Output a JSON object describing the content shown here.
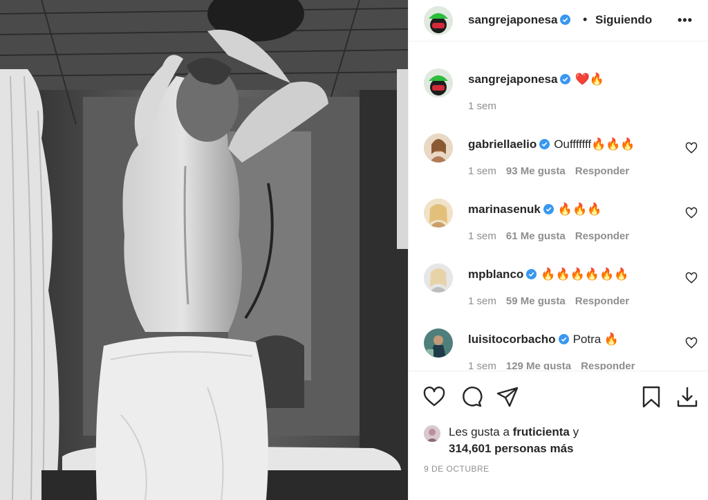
{
  "post": {
    "image_alt": "Fotografía en blanco y negro de una mujer de espaldas con una toalla en un baño rústico",
    "accent_color": "#0095f6"
  },
  "header": {
    "username": "sangrejaponesa",
    "separator": "•",
    "follow_label": "Siguiendo",
    "more_label": "•••",
    "avatar_icon": "avatar-green-hat-icon",
    "verified_icon": "verified-badge-icon"
  },
  "caption": {
    "username": "sangrejaponesa",
    "text": "❤️🔥",
    "time": "1 sem"
  },
  "comments": [
    {
      "username": "gabriellaelio",
      "text": "Oufffffff🔥🔥🔥",
      "time": "1 sem",
      "likes": "93 Me gusta",
      "reply": "Responder",
      "verified": true
    },
    {
      "username": "marinasenuk",
      "text": "🔥🔥🔥",
      "time": "1 sem",
      "likes": "61 Me gusta",
      "reply": "Responder",
      "verified": true
    },
    {
      "username": "mpblanco",
      "text": "🔥🔥🔥🔥🔥🔥",
      "time": "1 sem",
      "likes": "59 Me gusta",
      "reply": "Responder",
      "verified": true
    },
    {
      "username": "luisitocorbacho",
      "text": "Potra 🔥",
      "time": "1 sem",
      "likes": "129 Me gusta",
      "reply": "Responder",
      "verified": true
    }
  ],
  "actions": {
    "like_icon": "heart-icon",
    "comment_icon": "comment-icon",
    "share_icon": "paper-plane-icon",
    "save_icon": "bookmark-icon",
    "download_icon": "download-icon"
  },
  "likes": {
    "prefix": "Les gusta a",
    "user": "fruticienta",
    "connector": "y",
    "count": "314,601 personas más"
  },
  "date": "9 DE OCTUBRE"
}
